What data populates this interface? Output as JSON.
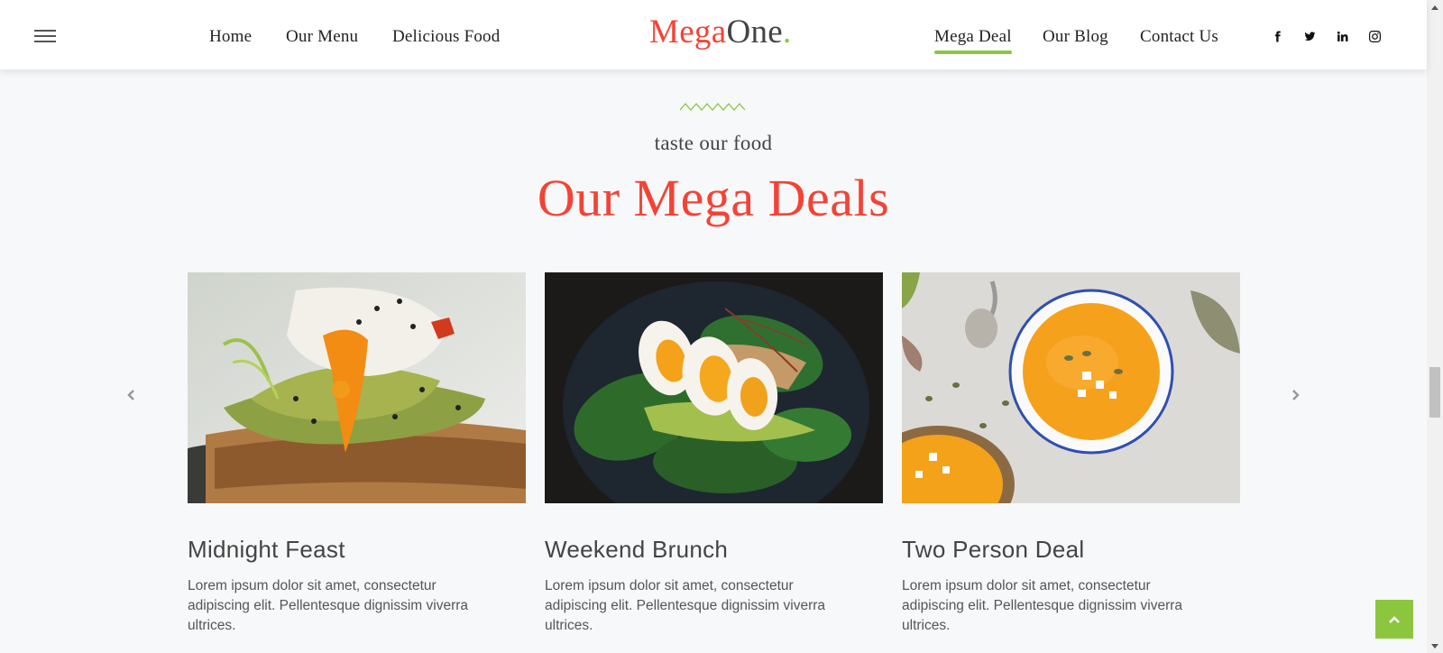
{
  "header": {
    "menu_icon": "hamburger-menu-icon",
    "nav_left": [
      {
        "label": "Home"
      },
      {
        "label": "Our Menu"
      },
      {
        "label": "Delicious Food"
      }
    ],
    "logo": {
      "part1": "Mega",
      "part2": "One",
      "dot": "."
    },
    "nav_right": [
      {
        "label": "Mega Deal",
        "active": true
      },
      {
        "label": "Our Blog"
      },
      {
        "label": "Contact Us"
      }
    ],
    "social": [
      "facebook-icon",
      "twitter-icon",
      "linkedin-icon",
      "instagram-icon"
    ]
  },
  "section": {
    "tagline": "taste our food",
    "title": "Our Mega Deals"
  },
  "deals": [
    {
      "title": "Midnight Feast",
      "text": "Lorem ipsum dolor sit amet, consectetur adipiscing elit. Pellentesque dignissim viverra ultrices.",
      "image": "avocado toast with poached egg"
    },
    {
      "title": "Weekend Brunch",
      "text": "Lorem ipsum dolor sit amet, consectetur adipiscing elit. Pellentesque dignissim viverra ultrices.",
      "image": "boiled eggs with spinach and avocado on dark plate"
    },
    {
      "title": "Two Person Deal",
      "text": "Lorem ipsum dolor sit amet, consectetur adipiscing elit. Pellentesque dignissim viverra ultrices.",
      "image": "pumpkin soup bowls with seeds"
    }
  ],
  "colors": {
    "accent_red": "#f44336",
    "accent_green": "#8cc63f",
    "background": "#f7f8fa"
  },
  "controls": {
    "prev_icon": "chevron-left-icon",
    "next_icon": "chevron-right-icon",
    "back_to_top_icon": "chevron-up-icon"
  }
}
